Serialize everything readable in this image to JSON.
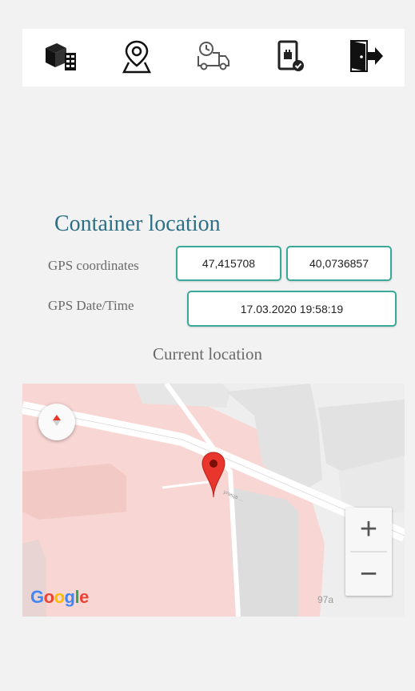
{
  "toolbar": {
    "icons": [
      "containers-icon",
      "map-pin-icon",
      "delivery-truck-icon",
      "phone-check-icon",
      "exit-door-icon"
    ]
  },
  "location": {
    "title": "Container location",
    "gps_label": "GPS coordinates",
    "latitude": "47,415708",
    "longitude": "40,0736857",
    "datetime_label": "GPS Date/Time",
    "datetime": "17.03.2020 19:58:19",
    "current_label": "Current location"
  },
  "map": {
    "attribution": "Google",
    "house_number": "97a",
    "street_label": "улица ...",
    "zoom_in": "+",
    "zoom_out": "−",
    "highlight_color": "#f8d6d3",
    "pin_color": "#e8362c"
  },
  "colors": {
    "accent": "#2c6f86",
    "field_border": "#3aa99a"
  }
}
